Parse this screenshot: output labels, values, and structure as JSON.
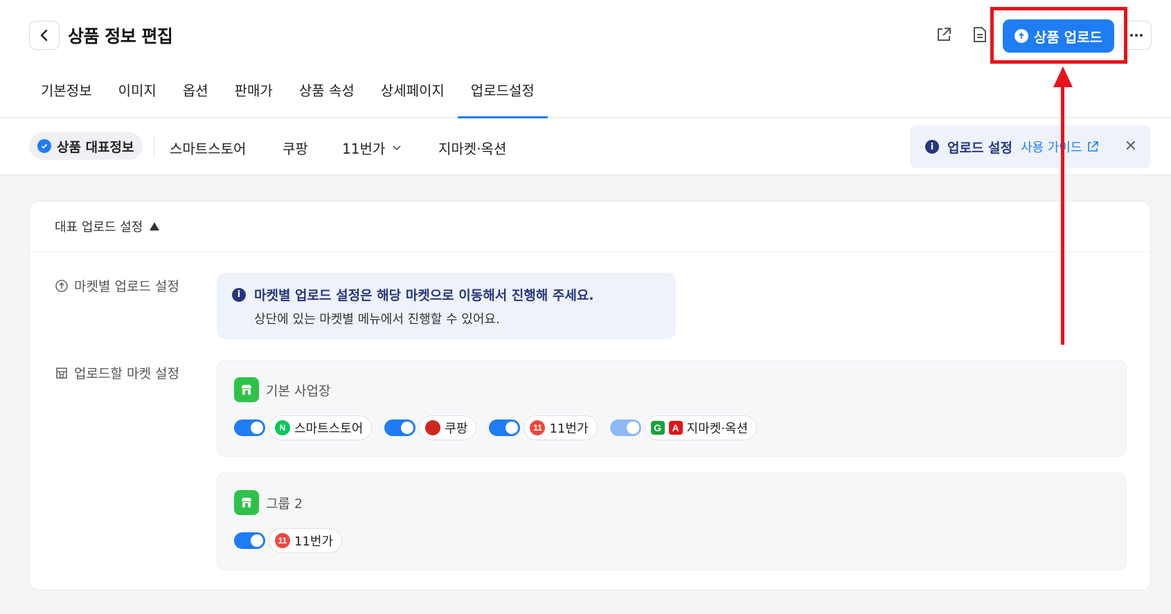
{
  "header": {
    "title": "상품 정보 편집",
    "upload_button": "상품 업로드"
  },
  "tabs": [
    {
      "label": "기본정보"
    },
    {
      "label": "이미지"
    },
    {
      "label": "옵션"
    },
    {
      "label": "판매가"
    },
    {
      "label": "상품 속성"
    },
    {
      "label": "상세페이지"
    },
    {
      "label": "업로드설정",
      "active": true
    }
  ],
  "subnav": {
    "active": "상품 대표정보",
    "items": [
      "스마트스토어",
      "쿠팡",
      "11번가",
      "지마켓·옥션"
    ],
    "guide": {
      "title": "업로드 설정",
      "link": "사용 가이드"
    }
  },
  "panel": {
    "header": "대표 업로드 설정",
    "market_setting_label": "마켓별 업로드 설정",
    "notice": {
      "line1": "마켓별 업로드 설정은 해당 마켓으로 이동해서 진행해 주세요.",
      "line2": "상단에 있는 마켓별 메뉴에서 진행할 수 있어요."
    },
    "upload_market_label": "업로드할 마켓 설정",
    "groups": [
      {
        "name": "기본 사업장",
        "markets": [
          "스마트스토어",
          "쿠팡",
          "11번가",
          "지마켓·옥션"
        ]
      },
      {
        "name": "그룹 2",
        "markets": [
          "11번가"
        ]
      }
    ]
  },
  "colors": {
    "accent": "#1e7cf5",
    "annotation": "#e8121a",
    "notice_text": "#26357f"
  }
}
